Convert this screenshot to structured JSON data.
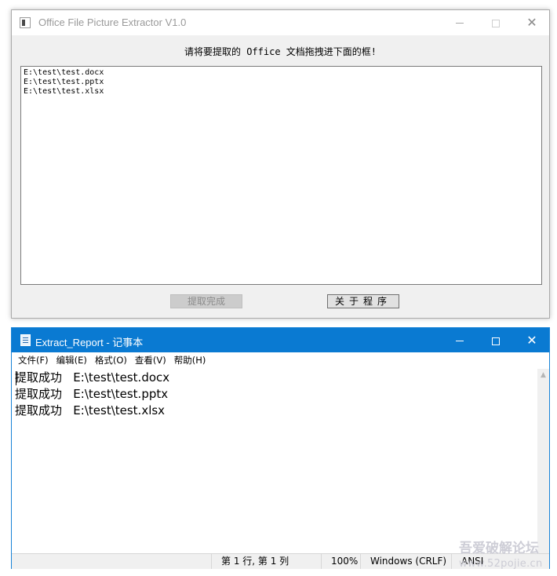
{
  "extractor": {
    "title": "Office File Picture Extractor V1.0",
    "instruction": "请将要提取的 Office 文档拖拽进下面的框!",
    "files": [
      "E:\\test\\test.docx",
      "E:\\test\\test.pptx",
      "E:\\test\\test.xlsx"
    ],
    "extract_button": "提取完成",
    "about_button": "关于程序"
  },
  "notepad": {
    "title": "Extract_Report - 记事本",
    "menu": [
      "文件(F)",
      "编辑(E)",
      "格式(O)",
      "查看(V)",
      "帮助(H)"
    ],
    "lines": [
      "提取成功   E:\\test\\test.docx",
      "提取成功   E:\\test\\test.pptx",
      "提取成功   E:\\test\\test.xlsx"
    ],
    "status": {
      "position": "第 1 行, 第 1 列",
      "zoom": "100%",
      "line_ending": "Windows (CRLF)",
      "encoding": "ANSI"
    }
  },
  "watermark": {
    "line1": "吾爱破解论坛",
    "line2": "www.52pojie.cn"
  },
  "icons": {
    "extractor_app": "app-window-icon",
    "notepad_app": "notepad-icon",
    "minimize": "minimize-icon",
    "maximize": "maximize-icon",
    "close": "close-icon"
  },
  "colors": {
    "notepad_titlebar": "#0a7ad2",
    "window_face": "#f0f0f0"
  }
}
